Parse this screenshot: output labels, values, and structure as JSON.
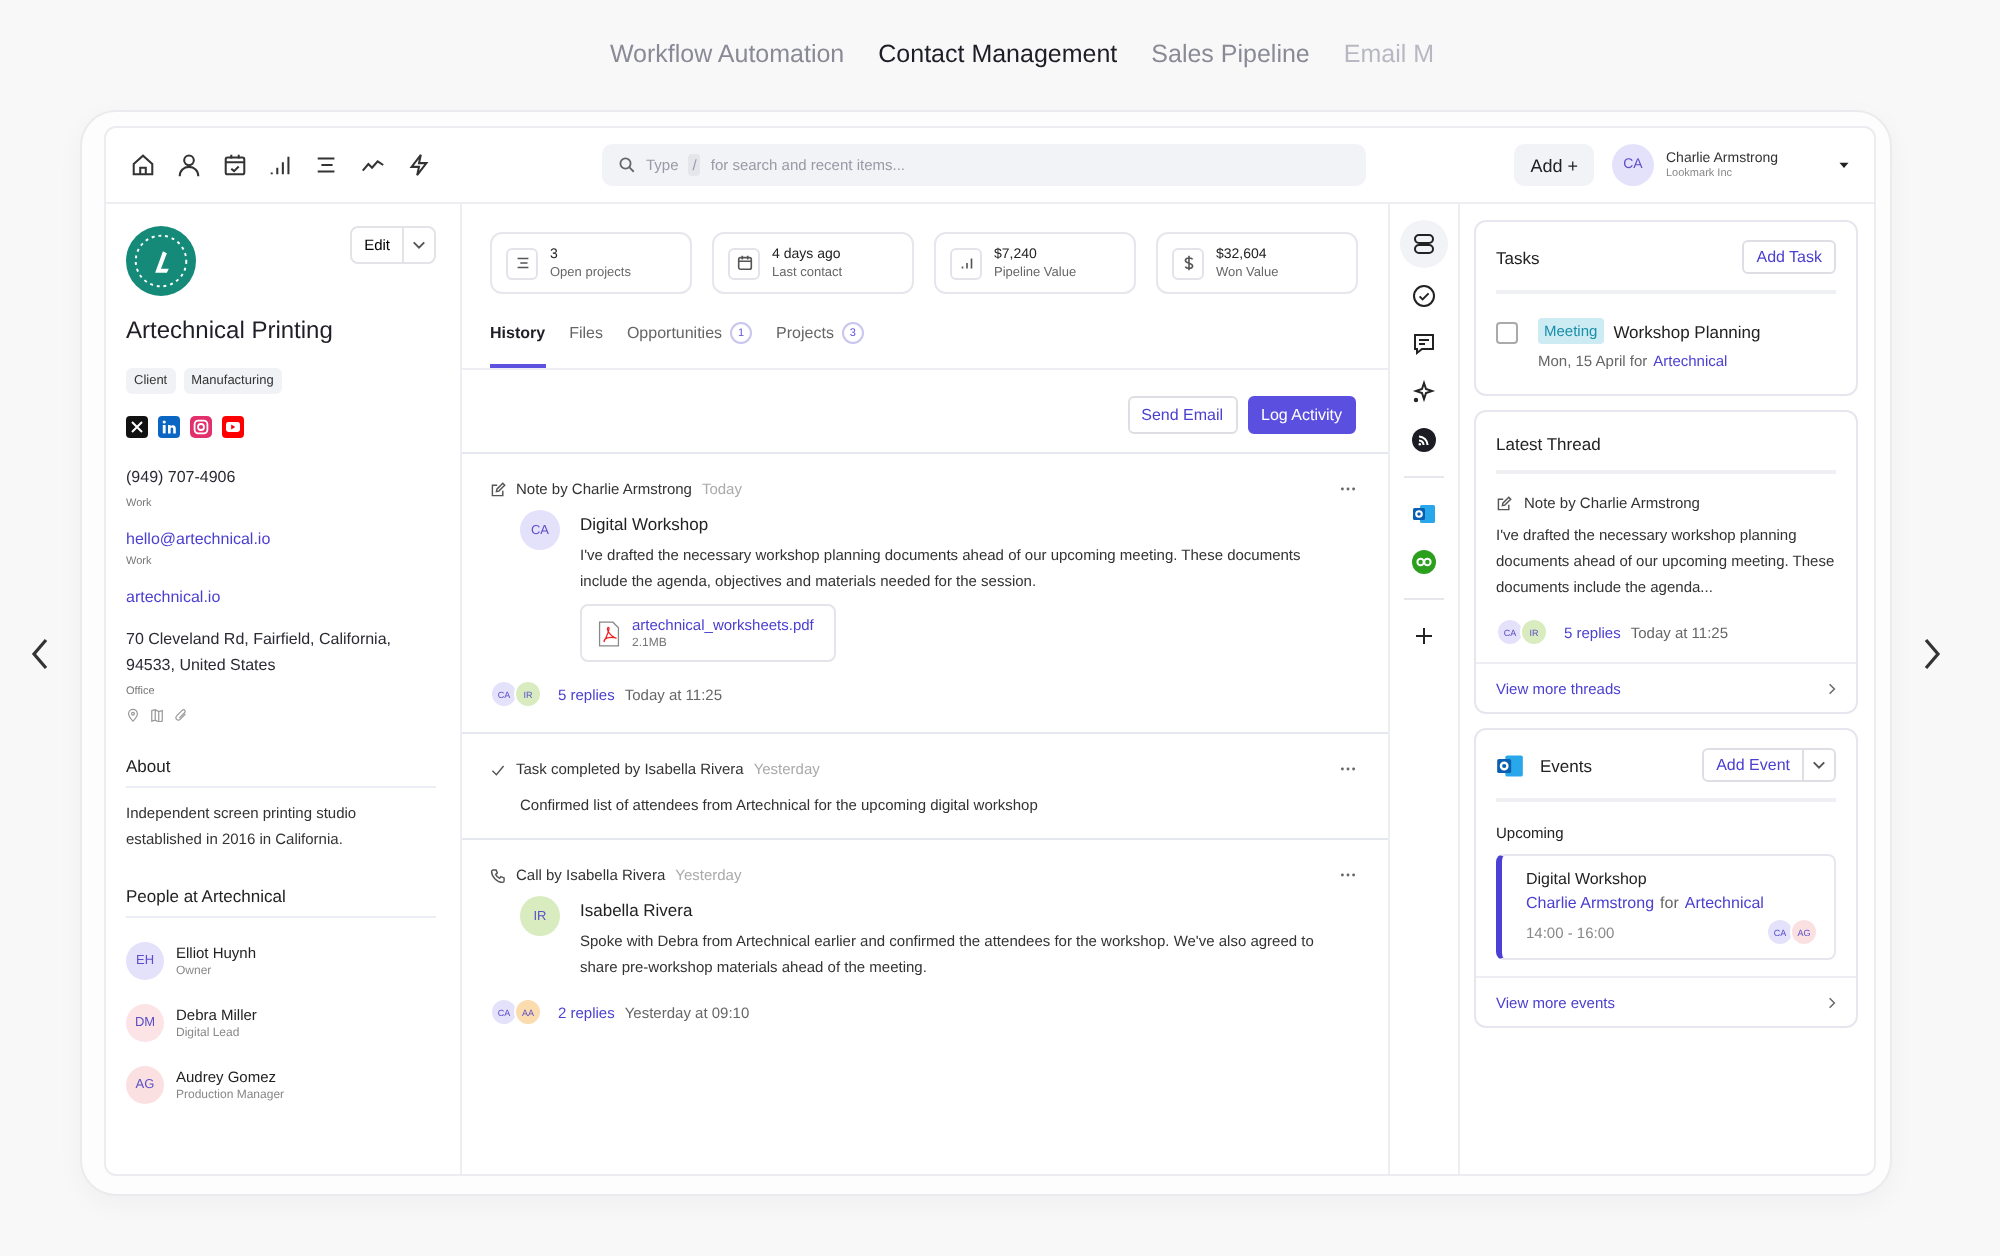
{
  "showcase_tabs": [
    {
      "label": "Workflow Automation",
      "selected": false
    },
    {
      "label": "Contact Management",
      "selected": true
    },
    {
      "label": "Sales Pipeline",
      "selected": false
    },
    {
      "label": "Email M",
      "selected": false
    }
  ],
  "search": {
    "hint": "Type",
    "key": "/",
    "placeholder": "for search and recent items..."
  },
  "add_button": "Add +",
  "user": {
    "initials": "CA",
    "name": "Charlie Armstrong",
    "company": "Lookmark Inc"
  },
  "company": {
    "name": "Artechnical Printing",
    "edit": "Edit",
    "tags": [
      "Client",
      "Manufacturing"
    ],
    "phone": "(949) 707-4906",
    "phone_label": "Work",
    "email": "hello@artechnical.io",
    "email_label": "Work",
    "website": "artechnical.io",
    "address": "70 Cleveland Rd, Fairfield, California, 94533, United States",
    "address_label": "Office"
  },
  "about": {
    "title": "About",
    "text": "Independent screen printing studio established in 2016 in California."
  },
  "people": {
    "title": "People at Artechnical",
    "items": [
      {
        "initials": "EH",
        "name": "Elliot Huynh",
        "role": "Owner",
        "color": "#e4e1fb"
      },
      {
        "initials": "DM",
        "name": "Debra Miller",
        "role": "Digital Lead",
        "color": "#fbe3e6"
      },
      {
        "initials": "AG",
        "name": "Audrey Gomez",
        "role": "Production Manager",
        "color": "#fbe0e2"
      }
    ]
  },
  "stats": [
    {
      "kind": "projects",
      "value": "3",
      "label": "Open projects"
    },
    {
      "kind": "contact",
      "value": "4 days ago",
      "label": "Last contact"
    },
    {
      "kind": "pipeline",
      "value": "$7,240",
      "label": "Pipeline Value"
    },
    {
      "kind": "won",
      "value": "$32,604",
      "label": "Won Value"
    }
  ],
  "tabs": [
    {
      "label": "History",
      "selected": true
    },
    {
      "label": "Files",
      "selected": false
    },
    {
      "label": "Opportunities",
      "count": "1",
      "selected": false
    },
    {
      "label": "Projects",
      "count": "3",
      "selected": false
    }
  ],
  "actions": [
    {
      "label": "Send Email",
      "kind": "secondary"
    },
    {
      "label": "Log Activity",
      "kind": "primary"
    }
  ],
  "history": [
    {
      "kind": "note",
      "title": "Note by Charlie Armstrong",
      "when": "Today",
      "author": {
        "initials": "CA",
        "color": "#e4e1fb"
      },
      "heading": "Digital Workshop",
      "text": "I've drafted the necessary workshop planning documents ahead of our upcoming meeting. These documents include the agenda, objectives and materials needed for the session.",
      "attachment": {
        "name": "artechnical_worksheets.pdf",
        "size": "2.1MB"
      },
      "replies": {
        "avatars": [
          {
            "initials": "CA",
            "color": "#e4e1fb"
          },
          {
            "initials": "IR",
            "color": "#d9ecc0"
          }
        ],
        "count": "5 replies",
        "time": "Today at 11:25"
      }
    },
    {
      "kind": "task",
      "title": "Task completed by Isabella Rivera",
      "when": "Yesterday",
      "text": "Confirmed list of attendees from Artechnical for the upcoming digital workshop"
    },
    {
      "kind": "call",
      "title": "Call by Isabella Rivera",
      "when": "Yesterday",
      "author": {
        "initials": "IR",
        "color": "#d9ecc0"
      },
      "heading": "Isabella Rivera",
      "text": "Spoke with Debra from Artechnical earlier and confirmed the attendees for the workshop. We've also agreed to share pre-workshop materials ahead of the meeting.",
      "replies": {
        "avatars": [
          {
            "initials": "CA",
            "color": "#e4e1fb"
          },
          {
            "initials": "AA",
            "color": "#fbdcae"
          }
        ],
        "count": "2 replies",
        "time": "Yesterday at 09:10"
      }
    }
  ],
  "tasks": {
    "title": "Tasks",
    "button": "Add Task",
    "items": [
      {
        "tag": "Meeting",
        "title": "Workshop Planning",
        "due": "Mon, 15 April for",
        "link": "Artechnical",
        "checked": false
      }
    ]
  },
  "thread": {
    "title": "Latest Thread",
    "note": "Note by Charlie Armstrong",
    "text": "I've drafted the necessary workshop planning documents ahead of our upcoming meeting. These documents include the agenda...",
    "replies": {
      "avatars": [
        {
          "initials": "CA",
          "color": "#e4e1fb"
        },
        {
          "initials": "IR",
          "color": "#d9ecc0"
        }
      ],
      "count": "5 replies",
      "time": "Today at 11:25"
    },
    "more": "View more threads"
  },
  "events": {
    "title": "Events",
    "button": "Add Event",
    "section": "Upcoming",
    "items": [
      {
        "title": "Digital Workshop",
        "person": "Charlie Armstrong",
        "joiner": "for",
        "link": "Artechnical",
        "time": "14:00 - 16:00",
        "avatars": [
          {
            "initials": "CA",
            "color": "#e4e1fb"
          },
          {
            "initials": "AG",
            "color": "#fbe0e2"
          }
        ]
      }
    ],
    "more": "View more events"
  }
}
